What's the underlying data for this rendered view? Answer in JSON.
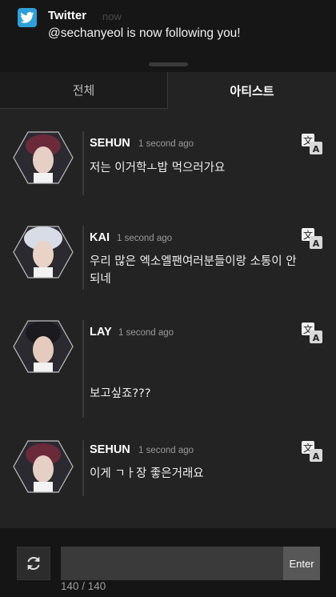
{
  "notification": {
    "app_name": "Twitter",
    "time": "now",
    "message": "@sechanyeol is now following you!"
  },
  "tabs": [
    {
      "label": "전체",
      "active": false
    },
    {
      "label": "아티스트",
      "active": true
    }
  ],
  "posts": [
    {
      "user": "SEHUN",
      "time": "1 second ago",
      "text": "저는 이거학ㅗ밥 먹으러가요",
      "avatar_hair": "#6a2a3a"
    },
    {
      "user": "KAI",
      "time": "1 second ago",
      "text": "우리 많은 엑소엘팬여러분들이랑 소통이 안되네",
      "avatar_hair": "#d8dce6"
    },
    {
      "user": "LAY",
      "time": "1 second ago",
      "text": "보고싶죠???",
      "avatar_hair": "#1a1a1f"
    },
    {
      "user": "SEHUN",
      "time": "1 second ago",
      "text": "이게 ㄱㅏ장 좋은거래요",
      "avatar_hair": "#6a2a3a"
    }
  ],
  "composer": {
    "enter_label": "Enter",
    "counter": "140 / 140",
    "value": ""
  },
  "colors": {
    "twitter_blue": "#2f9fd8",
    "background": "#232323"
  }
}
